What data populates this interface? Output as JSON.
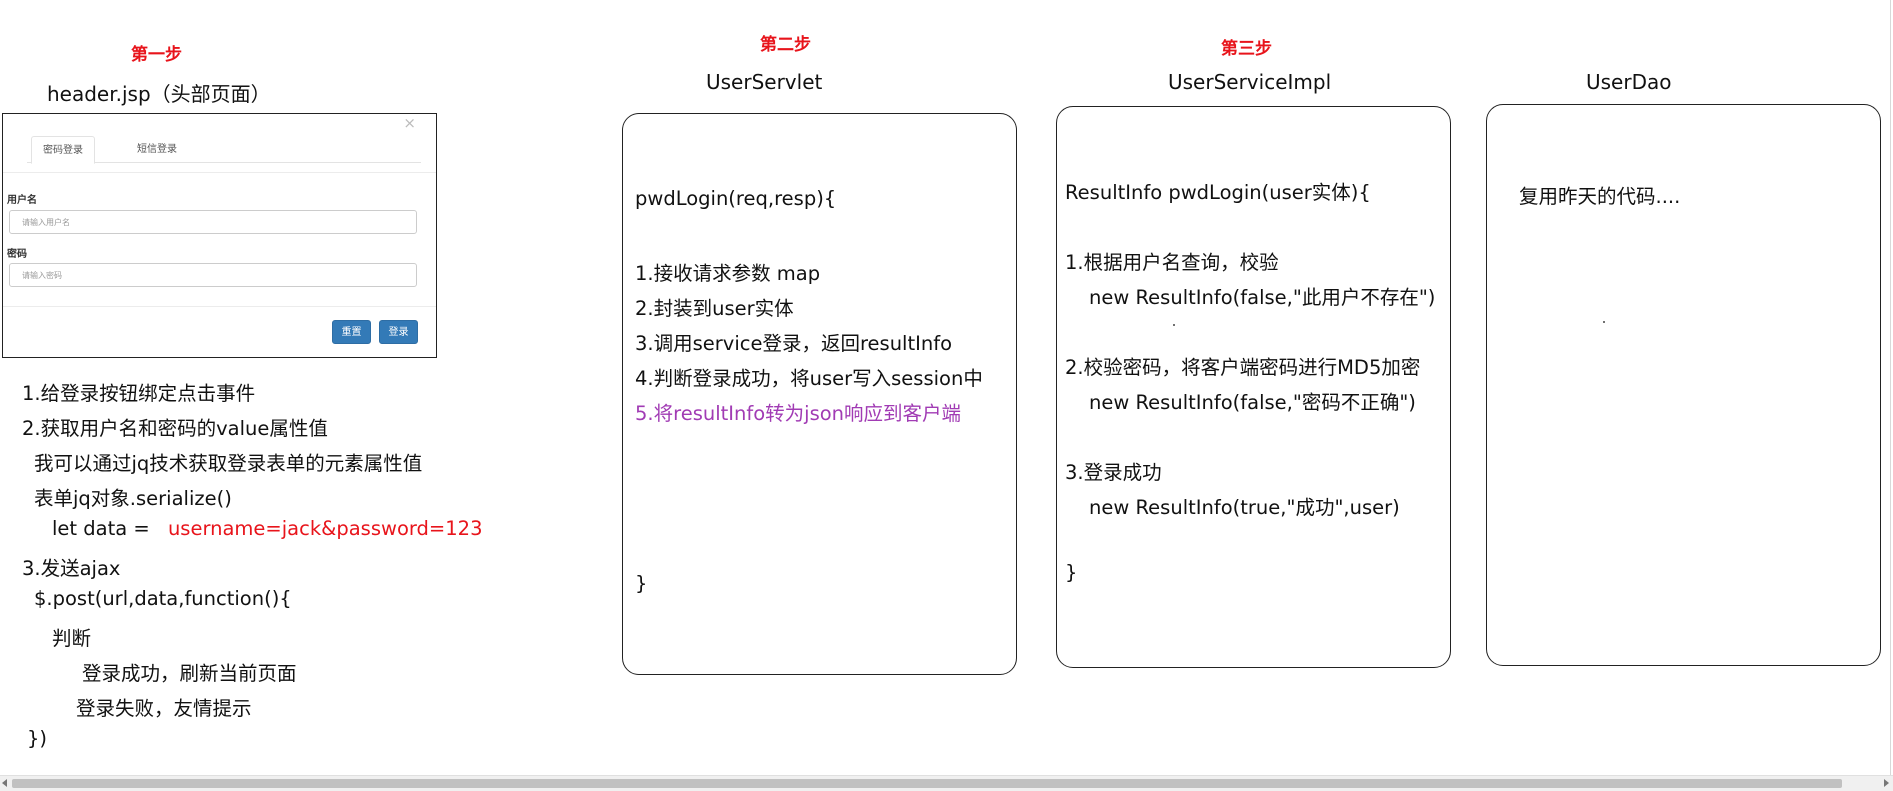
{
  "steps": {
    "step1": "第一步",
    "step2": "第二步",
    "step3": "第三步"
  },
  "titles": {
    "header_jsp": "header.jsp（头部页面）",
    "user_servlet": "UserServlet",
    "user_service_impl": "UserServiceImpl",
    "user_dao": "UserDao"
  },
  "login_dialog": {
    "close": "×",
    "tab_password": "密码登录",
    "tab_sms": "短信登录",
    "username_label": "用户名",
    "username_placeholder": "请输入用户名",
    "password_label": "密码",
    "password_placeholder": "请输入密码",
    "reset_button": "重置",
    "login_button": "登录"
  },
  "left_notes": {
    "l1": "1.给登录按钮绑定点击事件",
    "l2": "2.获取用户名和密码的value属性值",
    "l3": "我可以通过jq技术获取登录表单的元素属性值",
    "l4": "表单jq对象.serialize()",
    "l5_prefix": "let data =",
    "l5_value": "username=jack&password=123",
    "l6": "3.发送ajax",
    "l7": "$.post(url,data,function(){",
    "l8": "判断",
    "l9": "登录成功，刷新当前页面",
    "l10": "登录失败，友情提示",
    "l11": "})"
  },
  "servlet_box": {
    "l1": "pwdLogin(req,resp){",
    "l2": "1.接收请求参数 map",
    "l3": "2.封装到user实体",
    "l4": "3.调用service登录，返回resultInfo",
    "l5": "4.判断登录成功，将user写入session中",
    "l6": "5.将resultInfo转为json响应到客户端",
    "l7": "}"
  },
  "service_box": {
    "l1": "ResultInfo pwdLogin(user实体){",
    "l2": "1.根据用户名查询，校验",
    "l3": "new ResultInfo(false,\"此用户不存在\")",
    "l4": "2.校验密码，将客户端密码进行MD5加密",
    "l5": "new ResultInfo(false,\"密码不正确\")",
    "l6": "3.登录成功",
    "l7": "new ResultInfo(true,\"成功\",user)",
    "l8": "}"
  },
  "dao_box": {
    "l1": "复用昨天的代码...."
  },
  "colors": {
    "step": "#e8141b",
    "highlight_red": "#e8141b",
    "highlight_purple": "#a13bb4",
    "button_blue": "#337ab7"
  }
}
